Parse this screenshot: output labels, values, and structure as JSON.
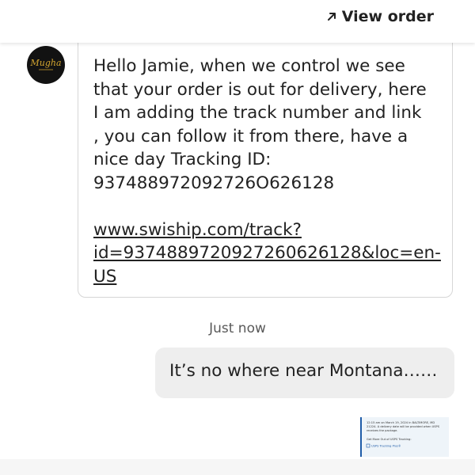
{
  "header": {
    "view_order_label": "View order",
    "icon": "arrow-up-right-icon"
  },
  "seller": {
    "avatar_text": "Mugha",
    "avatar_color": "#121212",
    "avatar_text_color": "#d4a630"
  },
  "messages": [
    {
      "direction": "incoming",
      "lines": [
        "Hello Jamie, when we control we see",
        "that your order is out for delivery, here",
        "I am adding the track number and link",
        ", you can follow it from there, have a",
        "nice day Tracking ID:",
        "937488972092726O626128"
      ],
      "link_lines": [
        "www.swiship.com/track?",
        "id=93748897209272606261​28&loc=en-",
        "US"
      ]
    },
    {
      "direction": "outgoing",
      "timestamp": "Just now",
      "text": "It’s no where near Montana……"
    }
  ],
  "attachment": {
    "type": "screenshot-thumbnail",
    "lines": [
      "12:15 am on March 19, 2024 in BALTIMORE, MD",
      "21224. A delivery date will be provided when USPS",
      "receives the package.",
      "Get More Out of USPS Tracking:",
      "USPS Tracking Plus®"
    ],
    "accent_color": "#1f5ca8"
  }
}
